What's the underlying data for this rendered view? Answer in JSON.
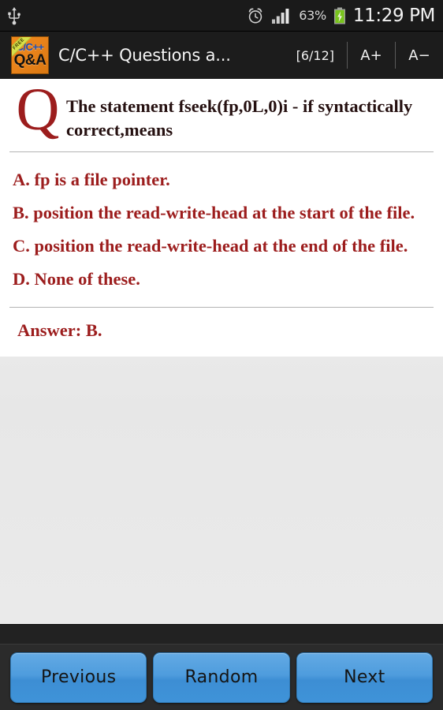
{
  "status_bar": {
    "usb_icon": "usb-icon",
    "alarm_icon": "alarm-clock-icon",
    "signal_icon": "signal-bars-icon",
    "battery_percent": "63%",
    "battery_icon": "battery-charging-icon",
    "time": "11:29 PM"
  },
  "header": {
    "app_icon": {
      "cpp_label": "C/C++",
      "qa_label": "Q&A",
      "ribbon_label": "FREE"
    },
    "title": "C/C++ Questions a...",
    "counter": "[6/12]",
    "font_increase": "A+",
    "font_decrease": "A−"
  },
  "question": {
    "marker": "Q",
    "text": "The statement fseek(fp,0L,0)i - if syntactically correct,means",
    "options": [
      "A. fp is a file pointer.",
      "B. position the read-write-head at the start of the file.",
      "C. position the read-write-head at the end of the file.",
      "D. None of these."
    ],
    "answer": "Answer: B."
  },
  "nav": {
    "previous": "Previous",
    "random": "Random",
    "next": "Next"
  },
  "colors": {
    "accent_red": "#9c1d1d",
    "button_blue": "#4e9cdd",
    "header_bg": "#1c1c1c",
    "icon_orange": "#e8821a"
  }
}
